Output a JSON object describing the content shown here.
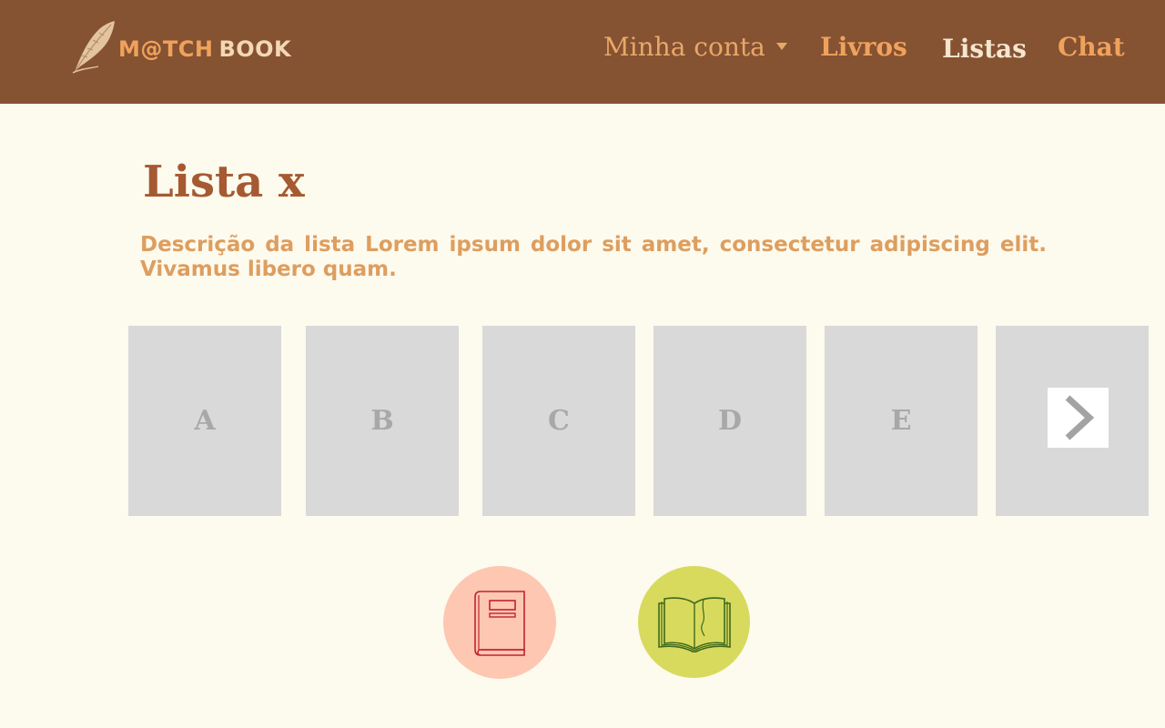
{
  "header": {
    "logo": {
      "word1": "M@TCH",
      "word2": "BOOK"
    },
    "nav": {
      "account": "Minha conta",
      "books": "Livros",
      "lists": "Listas",
      "chat": "Chat"
    }
  },
  "main": {
    "title": "Lista x",
    "description": "Descrição da lista Lorem ipsum dolor sit amet, consectetur adipiscing elit. Vivamus libero quam.",
    "cards": [
      "A",
      "B",
      "C",
      "D",
      "E"
    ]
  },
  "icons": {
    "next": "chevron-right-icon",
    "closed_book": "closed-book-icon",
    "open_book": "open-book-icon",
    "feather": "feather-quill-icon"
  },
  "colors": {
    "header_bg": "#855232",
    "page_bg": "#fdfaee",
    "title": "#a55a32",
    "description": "#dd9e5f",
    "card_bg": "#d9d9d9",
    "closed_book_btn": "#fdc7b1",
    "open_book_btn": "#d8da5e"
  }
}
